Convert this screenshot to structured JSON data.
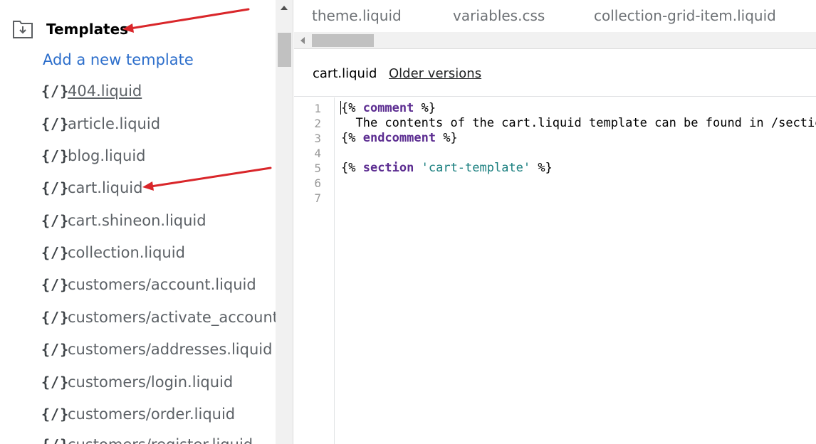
{
  "sidebar": {
    "section_title": "Templates",
    "add_link": "Add a new template",
    "file_icon_glyph": "{/}",
    "files": [
      "404.liquid",
      "article.liquid",
      "blog.liquid",
      "cart.liquid",
      "cart.shineon.liquid",
      "collection.liquid",
      "customers/account.liquid",
      "customers/activate_account.li",
      "customers/addresses.liquid",
      "customers/login.liquid",
      "customers/order.liquid",
      "customers/register.liquid"
    ]
  },
  "tabs": [
    "theme.liquid",
    "variables.css",
    "collection-grid-item.liquid"
  ],
  "editor": {
    "current_file": "cart.liquid",
    "older_versions": "Older versions",
    "line_numbers": [
      "1",
      "2",
      "3",
      "4",
      "5",
      "6",
      "7"
    ],
    "code": {
      "l1_open": "{% ",
      "l1_kw": "comment",
      "l1_close": " %}",
      "l2_text": "  The contents of the cart.liquid template can be found in /sections/cart-template.liquid",
      "l3_open": "{% ",
      "l3_kw": "endcomment",
      "l3_close": " %}",
      "l5_open": "{% ",
      "l5_kw": "section",
      "l5_str": "'cart-template'",
      "l5_close": " %}"
    }
  },
  "colors": {
    "link": "#2c6ecb",
    "keyword": "#5c2d91",
    "string": "#1a7f7f",
    "annotation_arrow": "#d9262a"
  },
  "icons": {
    "section_icon": "folder-download-icon",
    "file_icon": "liquid-file-icon"
  }
}
